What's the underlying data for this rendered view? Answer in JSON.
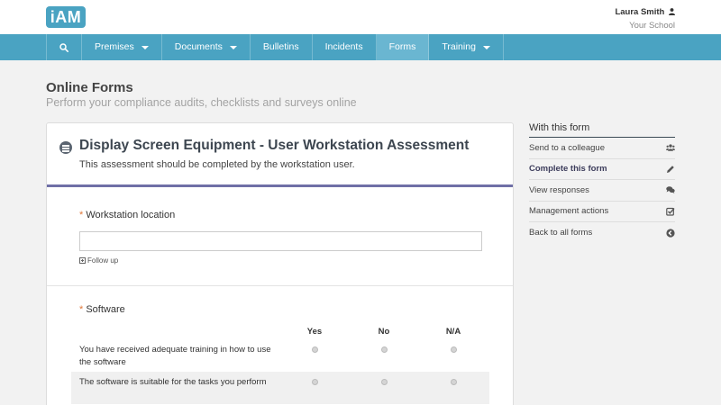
{
  "app": {
    "logo_text": "iAM"
  },
  "user": {
    "name": "Laura Smith",
    "school": "Your School"
  },
  "nav": {
    "items": [
      {
        "label": "Premises",
        "has_caret": true
      },
      {
        "label": "Documents",
        "has_caret": true
      },
      {
        "label": "Bulletins",
        "has_caret": false
      },
      {
        "label": "Incidents",
        "has_caret": false
      },
      {
        "label": "Forms",
        "has_caret": false,
        "active": true
      },
      {
        "label": "Training",
        "has_caret": true
      }
    ]
  },
  "page": {
    "title": "Online Forms",
    "subtitle": "Perform your compliance audits, checklists and surveys online"
  },
  "form": {
    "title": "Display Screen Equipment - User Workstation Assessment",
    "description": "This assessment should be completed by the workstation user.",
    "required_marker": "*",
    "q1": {
      "label": "Workstation location",
      "value": "",
      "followup_label": "Follow up"
    },
    "q2": {
      "label": "Software",
      "columns": [
        "Yes",
        "No",
        "N/A"
      ],
      "rows": [
        "You have received adequate training in how to use the software",
        "The software is suitable for the tasks you perform"
      ]
    }
  },
  "sidebar": {
    "title": "With this form",
    "items": [
      {
        "label": "Send to a colleague",
        "icon": "users-icon"
      },
      {
        "label": "Complete this form",
        "icon": "pencil-icon",
        "current": true
      },
      {
        "label": "View responses",
        "icon": "comments-icon"
      },
      {
        "label": "Management actions",
        "icon": "check-square-icon"
      },
      {
        "label": "Back to all forms",
        "icon": "arrow-circle-left-icon"
      }
    ]
  },
  "colors": {
    "brand": "#4aa3c2",
    "accent": "#6f6fa6",
    "required": "#e0783a"
  }
}
